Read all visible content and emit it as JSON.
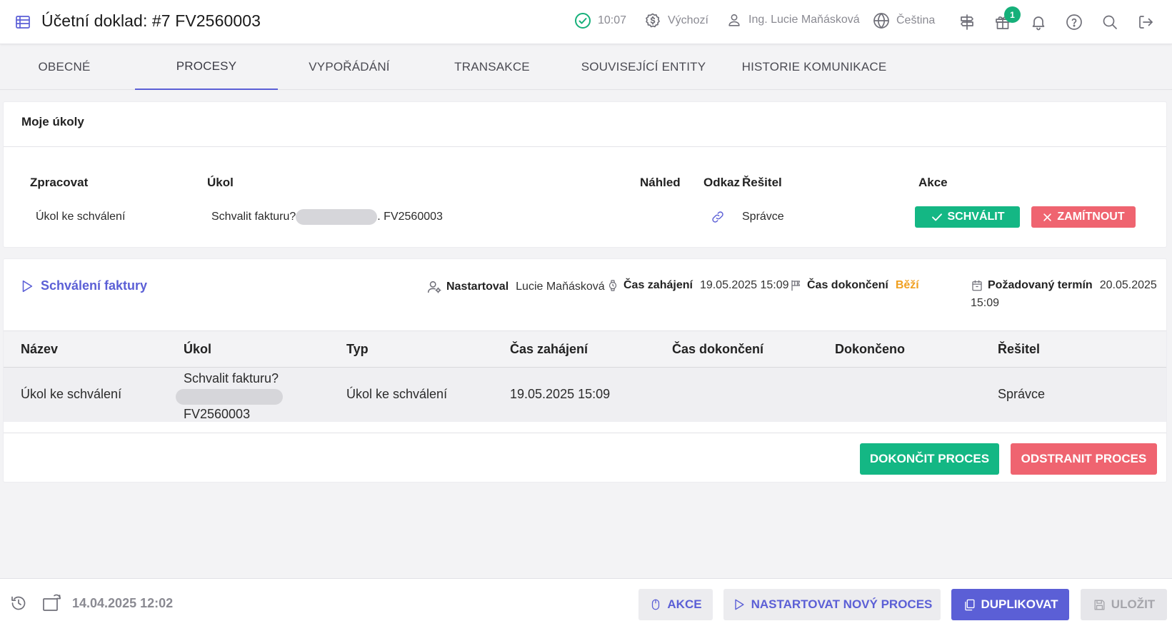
{
  "header": {
    "title": "Účetní doklad: #7 FV2560003",
    "time": "10:07",
    "currency_profile": "Výchozí",
    "user": "Ing. Lucie Maňásková",
    "language": "Čeština",
    "gift_badge": "1",
    "icons": [
      "document-table-icon",
      "check-circle-icon",
      "dollar-badge-icon",
      "user-icon",
      "globe-icon",
      "signpost-icon",
      "gift-icon",
      "bell-icon",
      "help-icon",
      "search-icon",
      "logout-icon"
    ]
  },
  "tabs": [
    {
      "label": "OBECNÉ"
    },
    {
      "label": "PROCESY",
      "active": true
    },
    {
      "label": "VYPOŘÁDÁNÍ"
    },
    {
      "label": "TRANSAKCE"
    },
    {
      "label": "SOUVISEJÍCÍ ENTITY"
    },
    {
      "label": "HISTORIE KOMUNIKACE"
    }
  ],
  "my_tasks": {
    "title": "Moje úkoly",
    "columns": [
      "Zpracovat",
      "Úkol",
      "Náhled",
      "Odkaz",
      "Řešitel",
      "Akce"
    ],
    "row": {
      "process": "Úkol ke schválení",
      "task_prefix": "Schvalit fakturu?",
      "task_suffix": ". FV2560003",
      "solver": "Správce",
      "approve_label": "SCHVÁLIT",
      "reject_label": "ZAMÍTNOUT"
    }
  },
  "process": {
    "name": "Schválení faktury",
    "started_by_label": "Nastartoval",
    "started_by": "Lucie Maňásková",
    "start_time_label": "Čas zahájení",
    "start_time": "19.05.2025 15:09",
    "end_time_label": "Čas dokončení",
    "status": "Běží",
    "deadline_label": "Požadovaný termín",
    "deadline_date": "20.05.2025",
    "deadline_time": "15:09",
    "columns": [
      "Název",
      "Úkol",
      "Typ",
      "Čas zahájení",
      "Čas dokončení",
      "Dokončeno",
      "Řešitel"
    ],
    "row": {
      "name": "Úkol ke schválení",
      "task_line1": "Schvalit fakturu?",
      "task_line3": "FV2560003",
      "type": "Úkol ke schválení",
      "start": "19.05.2025 15:09",
      "end": "",
      "done": "",
      "solver": "Správce"
    },
    "complete_label": "DOKONČIT PROCES",
    "delete_label": "ODSTRANIT PROCES"
  },
  "footer": {
    "timestamp": "14.04.2025 12:02",
    "actions_label": "AKCE",
    "start_new_label": "NASTARTOVAT NOVÝ PROCES",
    "duplicate_label": "DUPLIKOVAT",
    "save_label": "ULOŽIT"
  },
  "colors": {
    "accent": "#5b5fd6",
    "approve": "#14b784",
    "reject": "#ef6470",
    "running": "#f0a020"
  }
}
